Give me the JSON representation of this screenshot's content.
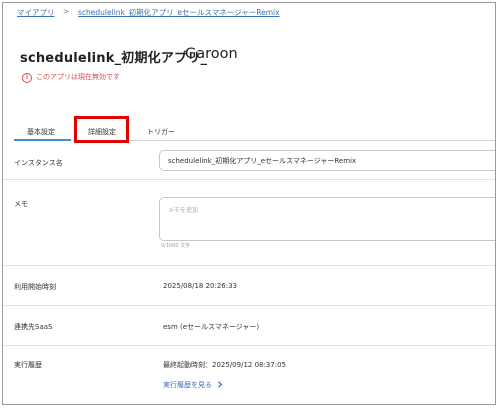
{
  "breadcrumb": {
    "root": "マイアプリ",
    "separator": ">",
    "current": "schedulelink_初期化アプリ_eセールスマネージャーRemix"
  },
  "app": {
    "title": "schedulelink_初期化アプリ_",
    "title_suffix": "Garoon",
    "status_warning": "このアプリは現在無効です",
    "warning_color": "#d94b4b"
  },
  "tabs": [
    {
      "label": "基本設定",
      "active": true
    },
    {
      "label": "詳細設定",
      "active": false,
      "highlighted": true
    },
    {
      "label": "トリガー",
      "active": false
    }
  ],
  "fields": {
    "instance": {
      "label": "インスタンス名",
      "value": "schedulelink_初期化アプリ_eセールスマネージャーRemix"
    },
    "memo": {
      "label": "メモ",
      "placeholder": "メモを追加",
      "counter": "0/1000 文字"
    },
    "start_time": {
      "label": "利用開始時刻",
      "value": "2025/08/18 20:26:33"
    },
    "saas": {
      "label": "連携先SaaS",
      "value": "esm (eセールスマネージャー)"
    },
    "history": {
      "label": "実行履歴",
      "last_run": "最終起動時刻：2025/09/12 08:37:05",
      "link": "実行履歴を見る"
    }
  },
  "icons": {
    "warning": "exclamation-circle-icon",
    "chevron": "chevron-right-icon"
  },
  "colors": {
    "accent": "#3d8fd8",
    "link": "#3f6fb5",
    "highlight_box": "#e00000"
  }
}
